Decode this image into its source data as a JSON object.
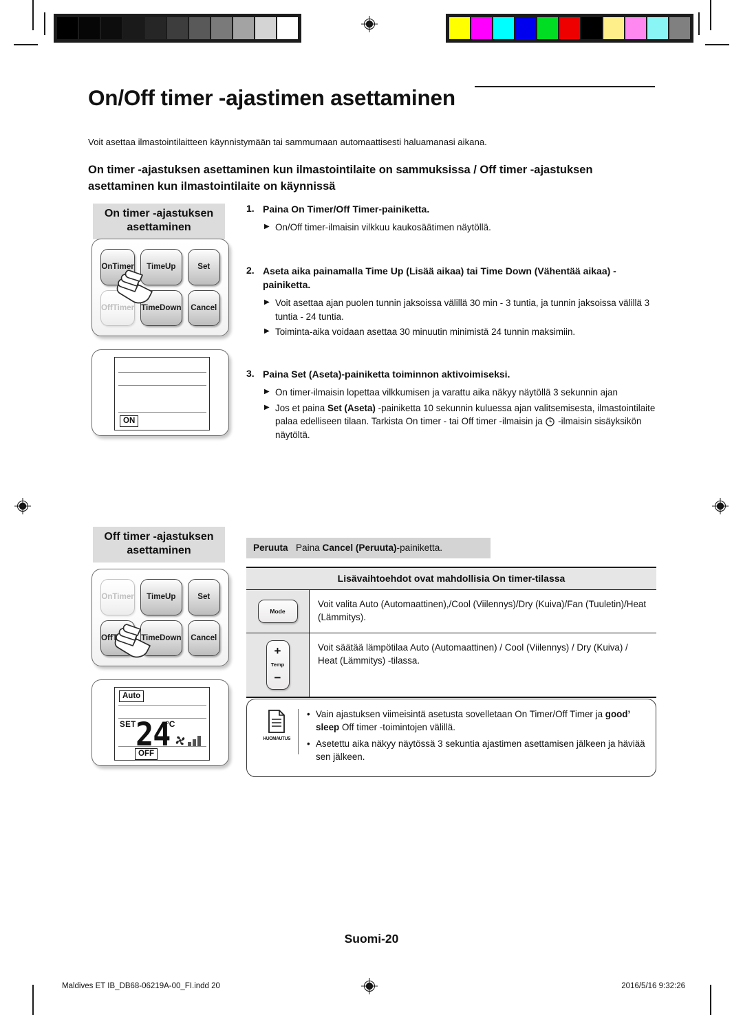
{
  "document": {
    "title": "On/Off timer -ajastimen asettaminen",
    "intro": "Voit asettaa ilmastointilaitteen käynnistymään tai sammumaan automaattisesti haluamanasi aikana.",
    "section_heading": "On timer -ajastuksen asettaminen kun ilmastointilaite on sammuksissa / Off timer -ajastuksen asettaminen kun ilmastointilaite on käynnissä"
  },
  "on_timer_panel": {
    "chip_line1": "On timer -ajastuksen",
    "chip_line2": "asettaminen",
    "buttons": [
      {
        "line1": "On",
        "line2": "Timer",
        "state": "active"
      },
      {
        "line1": "Time",
        "line2": "Up",
        "state": "active"
      },
      {
        "line1": "Set",
        "line2": "",
        "state": "active"
      },
      {
        "line1": "Off",
        "line2": "Timer",
        "state": "dim"
      },
      {
        "line1": "Time",
        "line2": "Down",
        "state": "active"
      },
      {
        "line1": "Cancel",
        "line2": "",
        "state": "active"
      }
    ],
    "display": {
      "indicator": "ON"
    }
  },
  "off_timer_panel": {
    "chip_line1": "Off timer -ajastuksen",
    "chip_line2": "asettaminen",
    "buttons": [
      {
        "line1": "On",
        "line2": "Timer",
        "state": "dim"
      },
      {
        "line1": "Time",
        "line2": "Up",
        "state": "active"
      },
      {
        "line1": "Set",
        "line2": "",
        "state": "active"
      },
      {
        "line1": "Off",
        "line2": "Timer",
        "state": "active"
      },
      {
        "line1": "Time",
        "line2": "Down",
        "state": "active"
      },
      {
        "line1": "Cancel",
        "line2": "",
        "state": "active"
      }
    ],
    "display": {
      "mode_tag": "Auto",
      "set_label": "SET",
      "temperature": "24",
      "unit": "°C",
      "indicator": "OFF"
    }
  },
  "steps": [
    {
      "number": "1.",
      "text_html": "Paina <b>On Timer/Off Timer</b>-painiketta.",
      "bullets": [
        "On/Off timer-ilmaisin vilkkuu kaukosäätimen näytöllä."
      ]
    },
    {
      "number": "2.",
      "text_html": "Aseta aika painamalla <b>Time Up (Lisää aikaa)</b> tai <b>Time Down (Vähentää aikaa)</b> -painiketta.",
      "bullets": [
        "Voit asettaa ajan puolen tunnin jaksoissa välillä 30 min - 3 tuntia, ja tunnin jaksoissa välillä 3 tuntia - 24 tuntia.",
        "Toiminta-aika voidaan asettaa 30 minuutin minimistä 24 tunnin maksimiin."
      ]
    },
    {
      "number": "3.",
      "text_html": "Paina <b>Set (Aseta)</b>-painiketta toiminnon aktivoimiseksi.",
      "bullets": [
        "On timer-ilmaisin lopettaa vilkkumisen ja varattu aika näkyy näytöllä 3 sekunnin ajan",
        "Jos et paina <b>Set (Aseta)</b> -painiketta 10 sekunnin kuluessa ajan valitsemisesta, ilmastointilaite palaa edelliseen tilaan. Tarkista On timer - tai Off timer -ilmaisin ja <span class=\"clock-slot\"></span> -ilmaisin sisäyksikön näytöltä."
      ]
    }
  ],
  "cancel_band": {
    "label": "Peruuta",
    "text_html": "Paina <b>Cancel (Peruuta)</b>-painiketta."
  },
  "options_table": {
    "header": "Lisävaihtoehdot ovat mahdollisia On timer-tilassa",
    "rows": [
      {
        "icon": "mode-button-icon",
        "icon_label": "Mode",
        "text": "Voit valita Auto (Automaattinen),/Cool (Viilennys)/Dry (Kuiva)/Fan (Tuuletin)/Heat (Lämmitys)."
      },
      {
        "icon": "temp-updown-button-icon",
        "icon_label": "Temp",
        "icon_plus": "+",
        "icon_minus": "−",
        "text": "Voit säätää lämpötilaa Auto (Automaattinen) / Cool (Viilennys) / Dry (Kuiva) / Heat (Lämmitys) -tilassa."
      }
    ]
  },
  "note": {
    "icon_caption": "HUOMAUTUS",
    "items_html": [
      "Vain ajastuksen viimeisintä asetusta sovelletaan On Timer/Off Timer ja <b>good’ sleep</b> Off timer -toimintojen välillä.",
      "Asetettu aika näkyy näytössä 3 sekuntia ajastimen asettamisen jälkeen ja häviää sen jälkeen."
    ]
  },
  "footer": {
    "page_label": "Suomi-20",
    "file_info": "Maldives ET IB_DB68-06219A-00_FI.indd   20",
    "timestamp": "2016/5/16   9:32:26"
  },
  "calibration": {
    "grayscale": [
      "#000000",
      "#060606",
      "#0d0d0d",
      "#1a1a1a",
      "#262626",
      "#3d3d3d",
      "#595959",
      "#7a7a7a",
      "#a3a3a3",
      "#d4d4d4",
      "#ffffff"
    ],
    "colors": [
      "#ffff00",
      "#ff00ff",
      "#00ffff",
      "#0000ee",
      "#00dd22",
      "#ee0000",
      "#000000",
      "#ffef8a",
      "#ff88f0",
      "#8af5f5",
      "#808080"
    ]
  }
}
